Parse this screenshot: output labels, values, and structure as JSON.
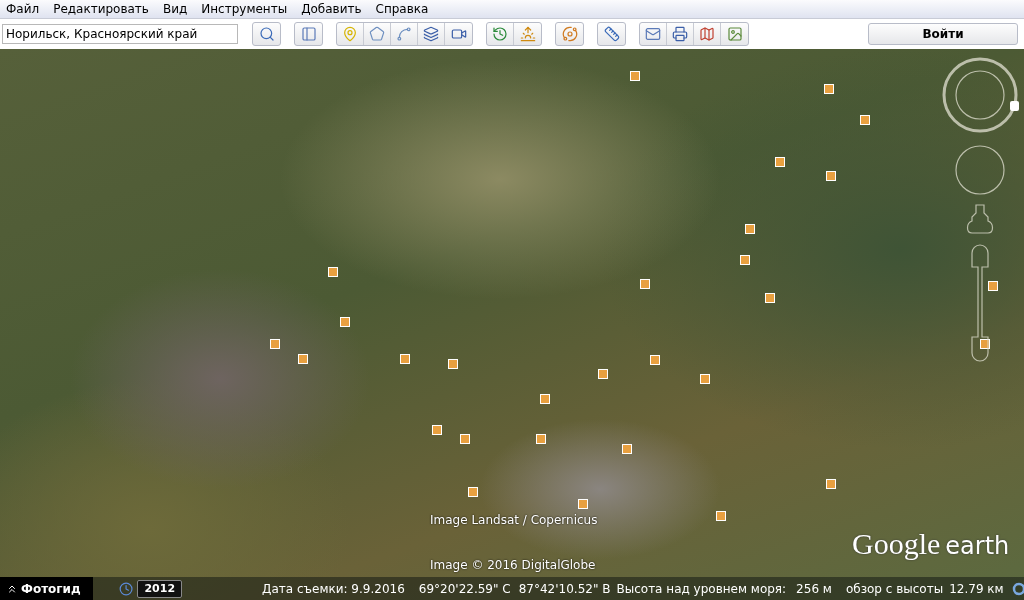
{
  "menu": [
    "Файл",
    "Редактировать",
    "Вид",
    "Инструменты",
    "Добавить",
    "Справка"
  ],
  "search": {
    "value": "Норильск, Красноярский край"
  },
  "login_button": "Войти",
  "map": {
    "attribution": [
      "Image Landsat / Copernicus",
      "Image © 2016 DigitalGlobe"
    ],
    "logo": {
      "brand": "Google",
      "product": "earth"
    }
  },
  "status_bar": {
    "photo_guide": "Фотогид",
    "historical_year": "2012",
    "capture_date": "Дата съемки: 9.9.2016",
    "latitude": "69°20'22.59\" С",
    "longitude": "87°42'10.52\" В",
    "elevation_label": "Высота над уровнем моря:",
    "elevation": "256 м",
    "eye_alt_label": "обзор с высоты",
    "eye_alt": "12.79 км"
  }
}
